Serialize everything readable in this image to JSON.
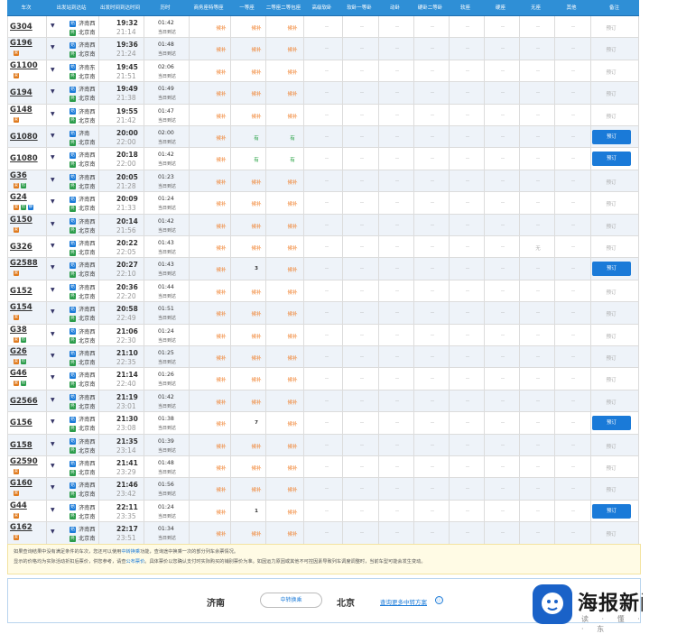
{
  "header": [
    "车次",
    "出发站到达站",
    "出发时间到达时间",
    "历时",
    "商务座特等座",
    "一等座",
    "二等座二等包座",
    "高级软卧",
    "软卧一等卧",
    "动卧",
    "硬卧二等卧",
    "软座",
    "硬座",
    "无座",
    "其他",
    "备注"
  ],
  "rows": [
    {
      "no": "G304",
      "tags": [],
      "from": "济南西",
      "to": "北京南",
      "dep": "19:32",
      "arr": "21:14",
      "dur": "01:42",
      "dur2": "当日到达",
      "c": [
        "候补",
        "候补",
        "候补",
        "--",
        "--",
        "--",
        "--",
        "--",
        "--",
        "--",
        "--"
      ],
      "book": "预订",
      "active": false
    },
    {
      "no": "G196",
      "tags": [
        "复"
      ],
      "from": "济南西",
      "to": "北京南",
      "dep": "19:36",
      "arr": "21:24",
      "dur": "01:48",
      "dur2": "当日到达",
      "c": [
        "候补",
        "候补",
        "候补",
        "--",
        "--",
        "--",
        "--",
        "--",
        "--",
        "--",
        "--"
      ],
      "book": "预订",
      "active": false
    },
    {
      "no": "G1100",
      "tags": [
        "复"
      ],
      "from": "济南东",
      "to": "北京南",
      "dep": "19:45",
      "arr": "21:51",
      "dur": "02:06",
      "dur2": "当日到达",
      "c": [
        "候补",
        "候补",
        "候补",
        "--",
        "--",
        "--",
        "--",
        "--",
        "--",
        "--",
        "--"
      ],
      "book": "预订",
      "active": false
    },
    {
      "no": "G194",
      "tags": [],
      "from": "济南西",
      "to": "北京南",
      "dep": "19:49",
      "arr": "21:38",
      "dur": "01:49",
      "dur2": "当日到达",
      "c": [
        "候补",
        "候补",
        "候补",
        "--",
        "--",
        "--",
        "--",
        "--",
        "--",
        "--",
        "--"
      ],
      "book": "预订",
      "active": false
    },
    {
      "no": "G148",
      "tags": [
        "复"
      ],
      "from": "济南西",
      "to": "北京南",
      "dep": "19:55",
      "arr": "21:42",
      "dur": "01:47",
      "dur2": "当日到达",
      "c": [
        "候补",
        "候补",
        "候补",
        "--",
        "--",
        "--",
        "--",
        "--",
        "--",
        "--",
        "--"
      ],
      "book": "预订",
      "active": false
    },
    {
      "no": "G1080",
      "tags": [],
      "from": "济南",
      "to": "北京南",
      "dep": "20:00",
      "arr": "22:00",
      "dur": "02:00",
      "dur2": "当日到达",
      "c": [
        "候补",
        "有",
        "有",
        "--",
        "--",
        "--",
        "--",
        "--",
        "--",
        "--",
        "--"
      ],
      "book": "预订",
      "active": true
    },
    {
      "no": "G1080",
      "tags": [],
      "from": "济南西",
      "to": "北京南",
      "dep": "20:18",
      "arr": "22:00",
      "dur": "01:42",
      "dur2": "当日到达",
      "c": [
        "候补",
        "有",
        "有",
        "--",
        "--",
        "--",
        "--",
        "--",
        "--",
        "--",
        "--"
      ],
      "book": "预订",
      "active": true
    },
    {
      "no": "G36",
      "tags": [
        "复",
        "智"
      ],
      "from": "济南西",
      "to": "北京南",
      "dep": "20:05",
      "arr": "21:28",
      "dur": "01:23",
      "dur2": "当日到达",
      "c": [
        "候补",
        "候补",
        "候补",
        "--",
        "--",
        "--",
        "--",
        "--",
        "--",
        "--",
        "--"
      ],
      "book": "预订",
      "active": false
    },
    {
      "no": "G24",
      "tags": [
        "复",
        "智",
        "静"
      ],
      "from": "济南西",
      "to": "北京南",
      "dep": "20:09",
      "arr": "21:33",
      "dur": "01:24",
      "dur2": "当日到达",
      "c": [
        "候补",
        "候补",
        "候补",
        "--",
        "--",
        "--",
        "--",
        "--",
        "--",
        "--",
        "--"
      ],
      "book": "预订",
      "active": false
    },
    {
      "no": "G150",
      "tags": [
        "复"
      ],
      "from": "济南西",
      "to": "北京南",
      "dep": "20:14",
      "arr": "21:56",
      "dur": "01:42",
      "dur2": "当日到达",
      "c": [
        "候补",
        "候补",
        "候补",
        "--",
        "--",
        "--",
        "--",
        "--",
        "--",
        "--",
        "--"
      ],
      "book": "预订",
      "active": false
    },
    {
      "no": "G326",
      "tags": [],
      "from": "济南西",
      "to": "北京南",
      "dep": "20:22",
      "arr": "22:05",
      "dur": "01:43",
      "dur2": "当日到达",
      "c": [
        "候补",
        "候补",
        "候补",
        "--",
        "--",
        "--",
        "--",
        "--",
        "--",
        "无",
        "--"
      ],
      "book": "预订",
      "active": false
    },
    {
      "no": "G2588",
      "tags": [
        "复"
      ],
      "from": "济南西",
      "to": "北京南",
      "dep": "20:27",
      "arr": "22:10",
      "dur": "01:43",
      "dur2": "当日到达",
      "c": [
        "候补",
        "3",
        "候补",
        "--",
        "--",
        "--",
        "--",
        "--",
        "--",
        "--",
        "--"
      ],
      "book": "预订",
      "active": true
    },
    {
      "no": "G152",
      "tags": [],
      "from": "济南西",
      "to": "北京南",
      "dep": "20:36",
      "arr": "22:20",
      "dur": "01:44",
      "dur2": "当日到达",
      "c": [
        "候补",
        "候补",
        "候补",
        "--",
        "--",
        "--",
        "--",
        "--",
        "--",
        "--",
        "--"
      ],
      "book": "预订",
      "active": false
    },
    {
      "no": "G154",
      "tags": [
        "复"
      ],
      "from": "济南西",
      "to": "北京南",
      "dep": "20:58",
      "arr": "22:49",
      "dur": "01:51",
      "dur2": "当日到达",
      "c": [
        "候补",
        "候补",
        "候补",
        "--",
        "--",
        "--",
        "--",
        "--",
        "--",
        "--",
        "--"
      ],
      "book": "预订",
      "active": false
    },
    {
      "no": "G38",
      "tags": [
        "复",
        "智"
      ],
      "from": "济南西",
      "to": "北京南",
      "dep": "21:06",
      "arr": "22:30",
      "dur": "01:24",
      "dur2": "当日到达",
      "c": [
        "候补",
        "候补",
        "候补",
        "--",
        "--",
        "--",
        "--",
        "--",
        "--",
        "--",
        "--"
      ],
      "book": "预订",
      "active": false
    },
    {
      "no": "G26",
      "tags": [
        "复",
        "智"
      ],
      "from": "济南西",
      "to": "北京南",
      "dep": "21:10",
      "arr": "22:35",
      "dur": "01:25",
      "dur2": "当日到达",
      "c": [
        "候补",
        "候补",
        "候补",
        "--",
        "--",
        "--",
        "--",
        "--",
        "--",
        "--",
        "--"
      ],
      "book": "预订",
      "active": false
    },
    {
      "no": "G46",
      "tags": [
        "复",
        "智"
      ],
      "from": "济南西",
      "to": "北京南",
      "dep": "21:14",
      "arr": "22:40",
      "dur": "01:26",
      "dur2": "当日到达",
      "c": [
        "候补",
        "候补",
        "候补",
        "--",
        "--",
        "--",
        "--",
        "--",
        "--",
        "--",
        "--"
      ],
      "book": "预订",
      "active": false
    },
    {
      "no": "G2566",
      "tags": [],
      "from": "济南西",
      "to": "北京南",
      "dep": "21:19",
      "arr": "23:01",
      "dur": "01:42",
      "dur2": "当日到达",
      "c": [
        "候补",
        "候补",
        "候补",
        "--",
        "--",
        "--",
        "--",
        "--",
        "--",
        "--",
        "--"
      ],
      "book": "预订",
      "active": false
    },
    {
      "no": "G156",
      "tags": [],
      "from": "济南西",
      "to": "北京南",
      "dep": "21:30",
      "arr": "23:08",
      "dur": "01:38",
      "dur2": "当日到达",
      "c": [
        "候补",
        "7",
        "候补",
        "--",
        "--",
        "--",
        "--",
        "--",
        "--",
        "--",
        "--"
      ],
      "book": "预订",
      "active": true
    },
    {
      "no": "G158",
      "tags": [],
      "from": "济南西",
      "to": "北京南",
      "dep": "21:35",
      "arr": "23:14",
      "dur": "01:39",
      "dur2": "当日到达",
      "c": [
        "候补",
        "候补",
        "候补",
        "--",
        "--",
        "--",
        "--",
        "--",
        "--",
        "--",
        "--"
      ],
      "book": "预订",
      "active": false
    },
    {
      "no": "G2590",
      "tags": [
        "复"
      ],
      "from": "济南西",
      "to": "北京南",
      "dep": "21:41",
      "arr": "23:29",
      "dur": "01:48",
      "dur2": "当日到达",
      "c": [
        "候补",
        "候补",
        "候补",
        "--",
        "--",
        "--",
        "--",
        "--",
        "--",
        "--",
        "--"
      ],
      "book": "预订",
      "active": false
    },
    {
      "no": "G160",
      "tags": [
        "复"
      ],
      "from": "济南西",
      "to": "北京南",
      "dep": "21:46",
      "arr": "23:42",
      "dur": "01:56",
      "dur2": "当日到达",
      "c": [
        "候补",
        "候补",
        "候补",
        "--",
        "--",
        "--",
        "--",
        "--",
        "--",
        "--",
        "--"
      ],
      "book": "预订",
      "active": false
    },
    {
      "no": "G44",
      "tags": [
        "复"
      ],
      "from": "济南西",
      "to": "北京南",
      "dep": "22:11",
      "arr": "23:35",
      "dur": "01:24",
      "dur2": "当日到达",
      "c": [
        "候补",
        "1",
        "候补",
        "--",
        "--",
        "--",
        "--",
        "--",
        "--",
        "--",
        "--"
      ],
      "book": "预订",
      "active": true
    },
    {
      "no": "G162",
      "tags": [
        "复"
      ],
      "from": "济南西",
      "to": "北京南",
      "dep": "22:17",
      "arr": "23:51",
      "dur": "01:34",
      "dur2": "当日到达",
      "c": [
        "候补",
        "候补",
        "候补",
        "--",
        "--",
        "--",
        "--",
        "--",
        "--",
        "--",
        "--"
      ],
      "book": "预订",
      "active": false
    }
  ],
  "note": {
    "line1_a": "如果查询结果中没有满足条件的车次，您还可以使用",
    "line1_link": "中转换乘",
    "line1_b": "功能，查询途中换乘一次的部分列车余票情况。",
    "line2_a": "显示的价格均为实际活动折扣后票价，供您参考，请查",
    "line2_link": "公布票价",
    "line2_b": "。具体票价以您确认支付时实际购买的铺别票价为准。如因运力原因或其他不可控因素导致列车调度调整时，当前车型可能会发生变动。"
  },
  "footer": {
    "from": "济南",
    "transfer": "中转换乘",
    "to": "北京",
    "more": "查询更多中转方案",
    "more_icon": "ⓘ"
  },
  "logo": {
    "name": "海报新闻",
    "sub": "读 · 懂 · 山 · 东"
  },
  "colors": {
    "header": "#2f8fd6",
    "book": "#1a7ad8",
    "waitlist": "#f07a22",
    "available": "#1e9e3b"
  }
}
